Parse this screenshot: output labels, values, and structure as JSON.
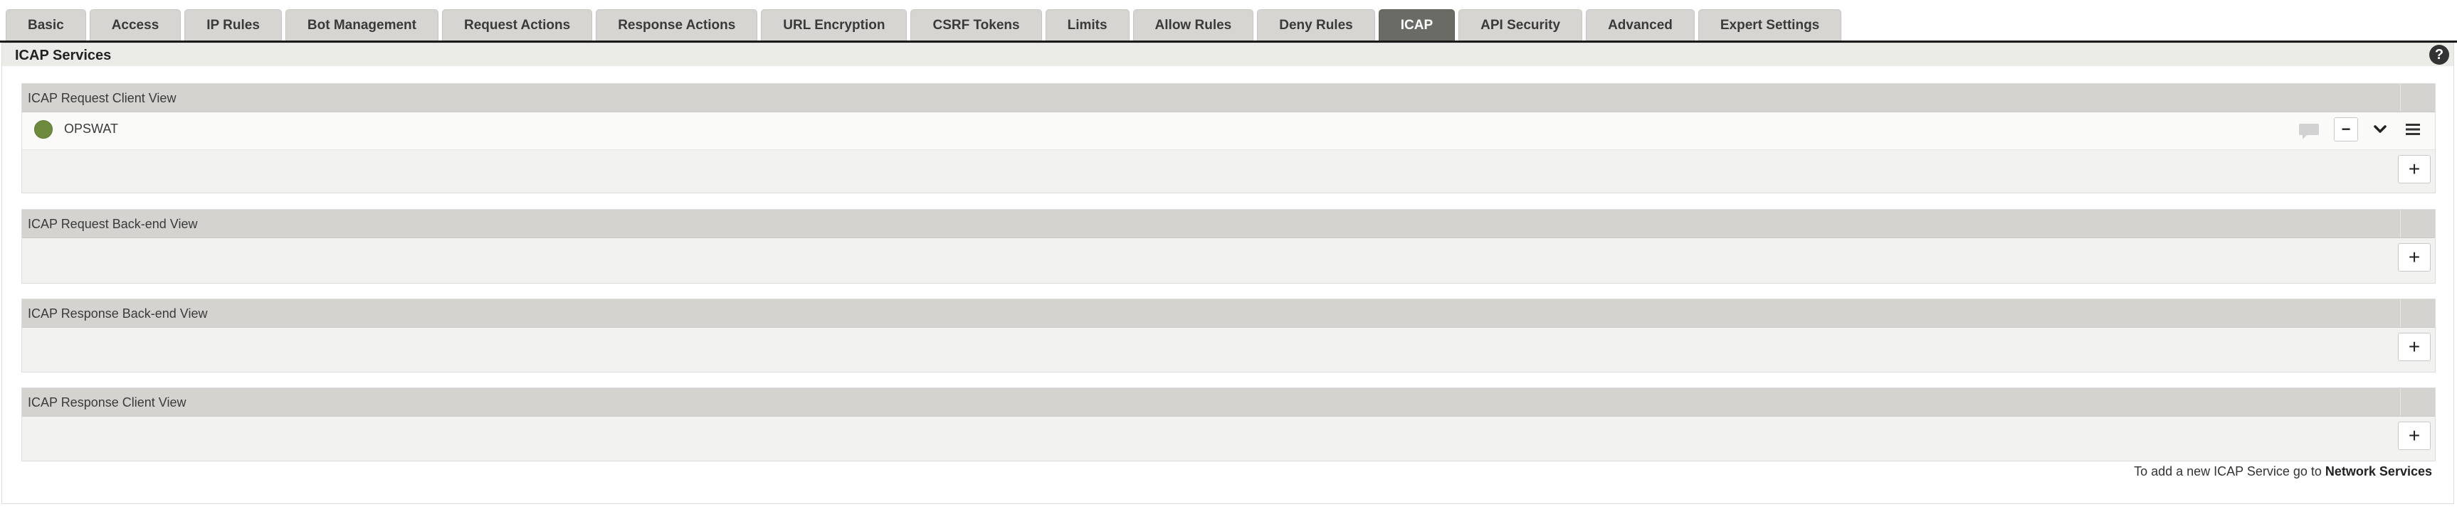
{
  "tabs": [
    {
      "label": "Basic",
      "active": false
    },
    {
      "label": "Access",
      "active": false
    },
    {
      "label": "IP Rules",
      "active": false
    },
    {
      "label": "Bot Management",
      "active": false
    },
    {
      "label": "Request Actions",
      "active": false
    },
    {
      "label": "Response Actions",
      "active": false
    },
    {
      "label": "URL Encryption",
      "active": false
    },
    {
      "label": "CSRF Tokens",
      "active": false
    },
    {
      "label": "Limits",
      "active": false
    },
    {
      "label": "Allow Rules",
      "active": false
    },
    {
      "label": "Deny Rules",
      "active": false
    },
    {
      "label": "ICAP",
      "active": true
    },
    {
      "label": "API Security",
      "active": false
    },
    {
      "label": "Advanced",
      "active": false
    },
    {
      "label": "Expert Settings",
      "active": false
    }
  ],
  "section": {
    "title": "ICAP Services",
    "help_symbol": "?"
  },
  "panels": [
    {
      "title": "ICAP Request Client View",
      "services": [
        {
          "name": "OPSWAT",
          "status_color": "#6e8b3d"
        }
      ]
    },
    {
      "title": "ICAP Request Back-end View",
      "services": []
    },
    {
      "title": "ICAP Response Back-end View",
      "services": []
    },
    {
      "title": "ICAP Response Client View",
      "services": []
    }
  ],
  "controls": {
    "add_symbol": "+",
    "remove_symbol": "−"
  },
  "icons": {
    "comment": "comment-icon",
    "remove": "minus-icon",
    "expand": "chevron-down-icon",
    "reorder": "menu-icon",
    "add": "plus-icon",
    "help": "help-icon"
  },
  "footer": {
    "text": "To add a new ICAP Service go to",
    "link": "Network Services"
  },
  "colors": {
    "active_tab": "#6b6b66",
    "status_online": "#6e8b3d"
  }
}
